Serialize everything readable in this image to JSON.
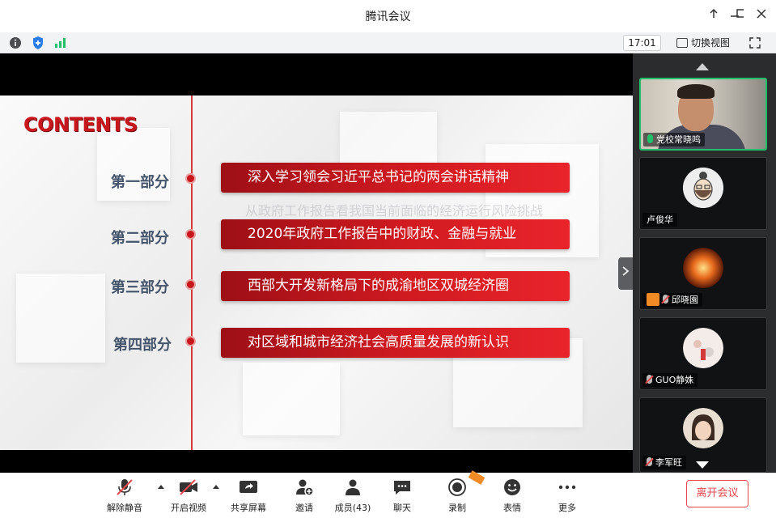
{
  "window": {
    "title": "腾讯会议"
  },
  "infobar": {
    "time": "17:01",
    "switch_view_label": "切换视图"
  },
  "slide": {
    "heading": "CONTENTS",
    "overlay_text": "从政府工作报告看我国当前面临的经济运行风险挑战",
    "rows": [
      {
        "label": "第一部分",
        "text": "深入学习领会习近平总书记的两会讲话精神"
      },
      {
        "label": "第二部分",
        "text": "2020年政府工作报告中的财政、金融与就业"
      },
      {
        "label": "第三部分",
        "text": "西部大开发新格局下的成渝地区双城经济圈"
      },
      {
        "label": "第四部分",
        "text": "对区域和城市经济社会高质量发展的新认识"
      }
    ]
  },
  "participants": [
    {
      "name": "党校常晓鸣",
      "mic": "active",
      "video": true
    },
    {
      "name": "卢俊华",
      "mic": "none",
      "video": false
    },
    {
      "name": "邱晓園",
      "mic": "muted",
      "video": false,
      "host": true
    },
    {
      "name": "GUO静姝",
      "mic": "muted",
      "video": false
    },
    {
      "name": "李军旺",
      "mic": "muted",
      "video": false
    }
  ],
  "toolbar": {
    "unmute": "解除静音",
    "start_video": "开启视频",
    "share_screen": "共享屏幕",
    "invite": "邀请",
    "members": "成员(43)",
    "chat": "聊天",
    "record": "录制",
    "reactions": "表情",
    "more": "更多",
    "leave": "离开会议"
  },
  "colors": {
    "accent_red": "#c8161d",
    "speaking_green": "#21c06a",
    "leave_red": "#e5484d"
  }
}
